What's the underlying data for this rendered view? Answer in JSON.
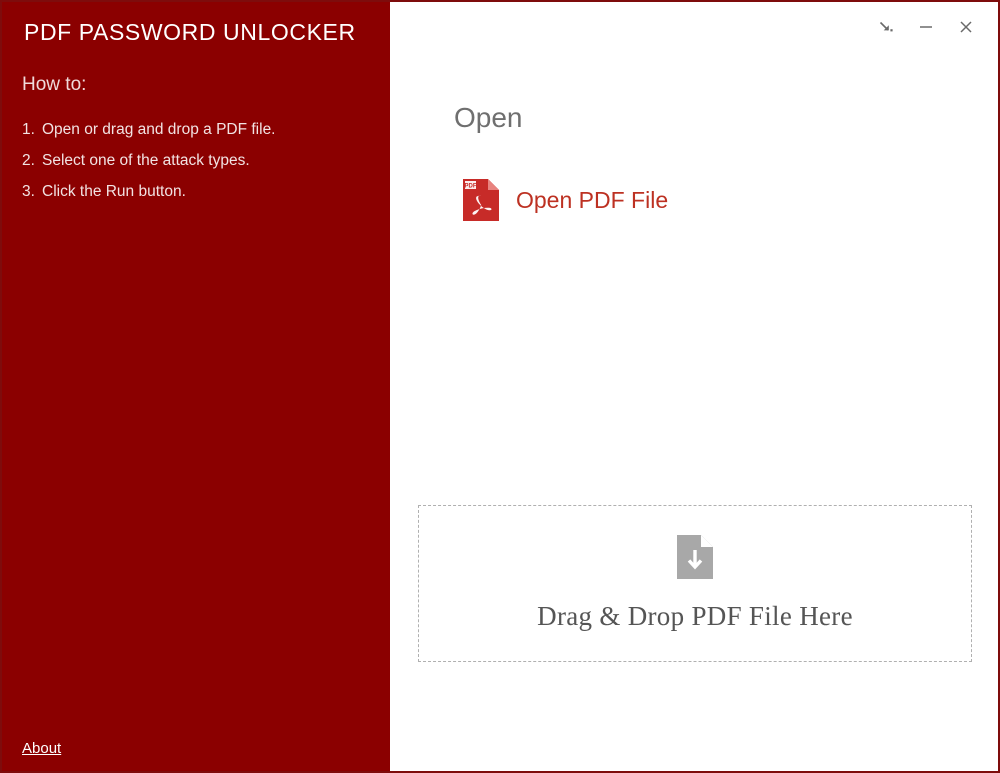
{
  "window": {
    "title": "PDF PASSWORD UNLOCKER",
    "accent_color": "#8b0000",
    "link_color": "#bd3122",
    "panel_bg": "#ffffff"
  },
  "sidebar": {
    "title": "PDF PASSWORD UNLOCKER",
    "howto_heading": "How to:",
    "steps": [
      {
        "num": "1.",
        "text": "Open or drag and drop a PDF file."
      },
      {
        "num": "2.",
        "text": "Select one of the attack types."
      },
      {
        "num": "3.",
        "text": "Click the Run button."
      }
    ],
    "about_label": "About"
  },
  "window_controls": [
    {
      "name": "minimize-to-tray",
      "icon": "arrow-to-corner-icon",
      "tooltip": "Minimize to tray"
    },
    {
      "name": "minimize",
      "icon": "minimize-icon",
      "tooltip": "Minimize"
    },
    {
      "name": "close",
      "icon": "close-icon",
      "tooltip": "Close"
    }
  ],
  "main": {
    "open_heading": "Open",
    "open_file_label": "Open PDF File",
    "open_file_icon": "pdf-file-icon",
    "drop_zone": {
      "icon": "document-download-icon",
      "text": "Drag & Drop PDF File Here"
    }
  }
}
